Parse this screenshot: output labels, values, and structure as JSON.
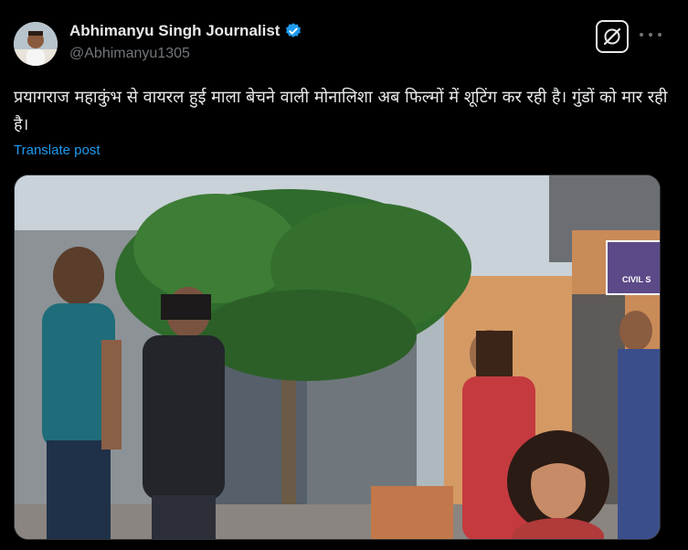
{
  "author": {
    "name": "Abhimanyu Singh Journalist",
    "handle": "@Abhimanyu1305",
    "avatar_icon": "profile-avatar",
    "verified_icon": "verified-badge-icon"
  },
  "header_actions": {
    "grok_icon": "grok-icon",
    "more_icon": "more-options-icon"
  },
  "post": {
    "text": "प्रयागराज महाकुंभ से वायरल हुई माला बेचने वाली मोनालिशा अब फिल्मों में शूटिंग कर रही है। गुंडों को मार रही है।",
    "translate_label": "Translate post"
  },
  "media": {
    "sign_text": "CIVIL S"
  },
  "colors": {
    "background": "#000000",
    "text": "#e7e9ea",
    "muted": "#71767b",
    "accent": "#1d9bf0"
  }
}
